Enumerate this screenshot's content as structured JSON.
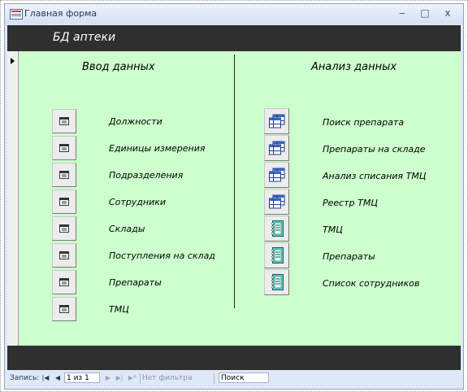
{
  "window": {
    "title": "Главная форма",
    "controls": {
      "minimize": "‒",
      "maximize": "□",
      "close": "x"
    }
  },
  "header": {
    "title": "БД аптеки"
  },
  "left_section": {
    "title": "Ввод данных",
    "items": [
      {
        "label": "Должности",
        "icon": "form-icon"
      },
      {
        "label": "Единицы измерения",
        "icon": "form-icon"
      },
      {
        "label": "Подразделения",
        "icon": "form-icon"
      },
      {
        "label": "Сотрудники",
        "icon": "form-icon"
      },
      {
        "label": "Склады",
        "icon": "form-icon"
      },
      {
        "label": "Поступления на склад",
        "icon": "form-icon"
      },
      {
        "label": "Препараты",
        "icon": "form-icon"
      },
      {
        "label": "ТМЦ",
        "icon": "form-icon"
      }
    ]
  },
  "right_section": {
    "title": "Анализ данных",
    "items": [
      {
        "label": "Поиск препарата",
        "icon": "query-icon"
      },
      {
        "label": "Препараты на складе",
        "icon": "query-icon"
      },
      {
        "label": "Анализ списания ТМЦ",
        "icon": "query-icon"
      },
      {
        "label": "Реестр ТМЦ",
        "icon": "query-icon"
      },
      {
        "label": "ТМЦ",
        "icon": "report-icon"
      },
      {
        "label": "Препараты",
        "icon": "report-icon"
      },
      {
        "label": "Список сотрудников",
        "icon": "report-icon"
      }
    ]
  },
  "navigation": {
    "record_label": "Запись:",
    "first": "|◀",
    "prev": "◀",
    "current": "1 из 1",
    "next": "▶",
    "last": "▶|",
    "new": "▶*",
    "filter_label": "Нет фильтра",
    "search_placeholder": "Поиск"
  },
  "colors": {
    "detail_background": "#ccffcc",
    "band_background": "#2f2f2f",
    "title_text": "#ffffff"
  }
}
